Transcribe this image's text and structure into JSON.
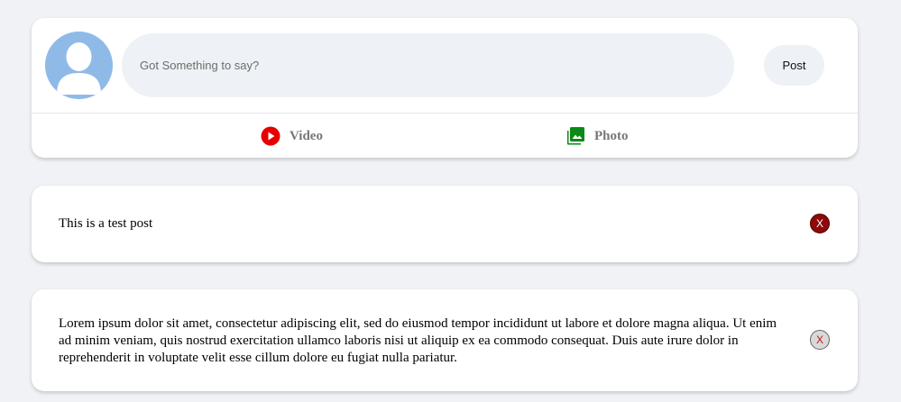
{
  "composer": {
    "placeholder": "Got Something to say?",
    "post_label": "Post",
    "media": [
      {
        "label": "Video",
        "icon": "play-circle-icon",
        "color": "#e60000"
      },
      {
        "label": "Photo",
        "icon": "photo-library-icon",
        "color": "#0a8a16"
      }
    ]
  },
  "posts": [
    {
      "text": "This is a test post",
      "delete_label": "X",
      "delete_style": "active"
    },
    {
      "text": "Lorem ipsum dolor sit amet, consectetur adipiscing elit, sed do eiusmod tempor incididunt ut labore et dolore magna aliqua. Ut enim ad minim veniam, quis nostrud exercitation ullamco laboris nisi ut aliquip ex ea commodo consequat. Duis aute irure dolor in reprehenderit in voluptate velit esse cillum dolore eu fugiat nulla pariatur.",
      "delete_label": "X",
      "delete_style": "default"
    }
  ],
  "colors": {
    "background": "#f0f2f5",
    "card": "#ffffff",
    "input_bg": "#eef1f5",
    "avatar": "#8fbae8"
  }
}
